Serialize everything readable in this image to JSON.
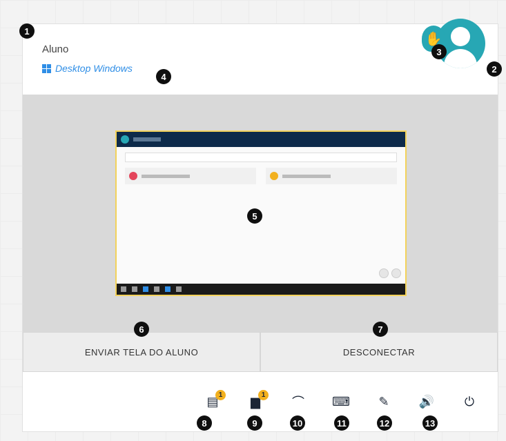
{
  "student": {
    "name": "Aluno",
    "os_label": "Desktop Windows"
  },
  "actions": {
    "send_screen": "ENVIAR TELA DO ALUNO",
    "disconnect": "DESCONECTAR"
  },
  "toolbar": {
    "items": [
      {
        "icon": "document-icon",
        "badge": "1"
      },
      {
        "icon": "chat-icon",
        "badge": "1"
      },
      {
        "icon": "mouse-icon"
      },
      {
        "icon": "keyboard-icon"
      },
      {
        "icon": "pencil-icon"
      },
      {
        "icon": "volume-icon"
      },
      {
        "icon": "power-icon"
      }
    ]
  },
  "callouts": [
    "1",
    "2",
    "3",
    "4",
    "5",
    "6",
    "7",
    "8",
    "9",
    "10",
    "11",
    "12",
    "13"
  ],
  "colors": {
    "accent": "#27a7b4",
    "link": "#2f8ee6",
    "badge": "#f2b01e"
  }
}
